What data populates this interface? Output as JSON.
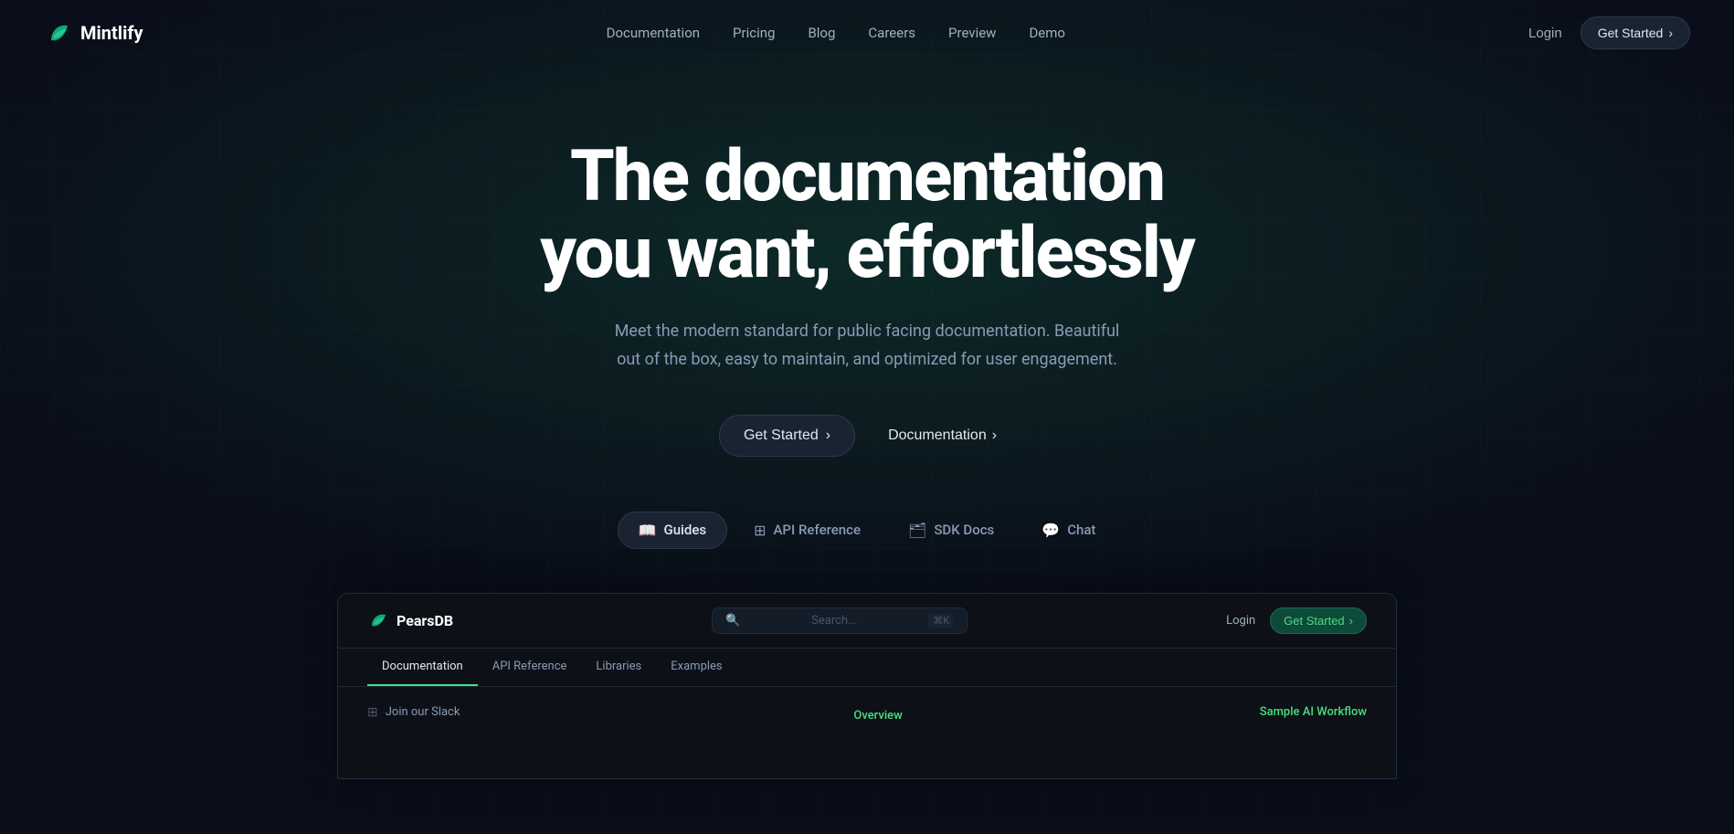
{
  "nav": {
    "logo_text": "Mintlify",
    "links": [
      {
        "label": "Documentation",
        "id": "nav-documentation"
      },
      {
        "label": "Pricing",
        "id": "nav-pricing"
      },
      {
        "label": "Blog",
        "id": "nav-blog"
      },
      {
        "label": "Careers",
        "id": "nav-careers"
      },
      {
        "label": "Preview",
        "id": "nav-preview"
      },
      {
        "label": "Demo",
        "id": "nav-demo"
      }
    ],
    "login_label": "Login",
    "get_started_label": "Get Started",
    "get_started_arrow": "›"
  },
  "hero": {
    "title": "The documentation you want, effortlessly",
    "subtitle": "Meet the modern standard for public facing documentation. Beautiful out of the box, easy to maintain, and optimized for user engagement.",
    "cta_primary_label": "Get Started",
    "cta_primary_arrow": "›",
    "cta_secondary_label": "Documentation",
    "cta_secondary_arrow": "›"
  },
  "tabs": [
    {
      "id": "guides",
      "label": "Guides",
      "icon": "📖",
      "active": true
    },
    {
      "id": "api-reference",
      "label": "API Reference",
      "icon": "⊞",
      "active": false
    },
    {
      "id": "sdk-docs",
      "label": "SDK Docs",
      "icon": "🗂",
      "active": false
    },
    {
      "id": "chat",
      "label": "Chat",
      "icon": "💬",
      "active": false
    }
  ],
  "demo": {
    "logo_text": "PearsDB",
    "search_placeholder": "Search...",
    "search_kbd": "⌘K",
    "login_label": "Login",
    "get_started_label": "Get Started",
    "get_started_arrow": "›",
    "nav_tabs": [
      {
        "label": "Documentation",
        "active": true
      },
      {
        "label": "API Reference",
        "active": false
      },
      {
        "label": "Libraries",
        "active": false
      },
      {
        "label": "Examples",
        "active": false
      }
    ],
    "sidebar_item_label": "Join our Slack",
    "sidebar_item_icon": "⊞",
    "overview_link": "Overview",
    "sample_link": "Sample AI Workflow"
  }
}
